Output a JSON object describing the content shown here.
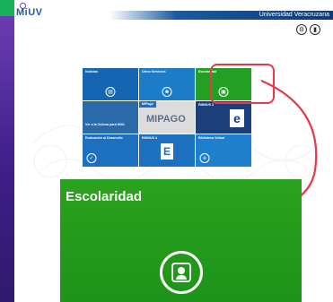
{
  "brand": {
    "logo_text": "MiUV",
    "university": "Universidad Veracruzana"
  },
  "header_icons": [
    "accessibility-icon",
    "user-icon"
  ],
  "tiles": [
    {
      "label": "Noticias",
      "color": "#1565b3"
    },
    {
      "label": "Otros Servicios",
      "color": "#1c7cc8"
    },
    {
      "label": "Escolaridad",
      "color": "#23a023"
    },
    {
      "label": "Ver a la Cultura para MiUL",
      "color": "#2a6aa8"
    },
    {
      "label": "MiPago",
      "color": "#d9d9d9"
    },
    {
      "label": "EMINUS 3",
      "color": "#1a3f7a"
    },
    {
      "label": "Evaluación al Desarrollo",
      "color": "#1d6fbf"
    },
    {
      "label": "EMINUS 4",
      "color": "#1d6fbf"
    },
    {
      "label": "Biblioteca Virtual",
      "color": "#1e7fcc"
    }
  ],
  "mipago_brand": "MIPAGO",
  "zoom": {
    "title": "Escolaridad",
    "color": "#23a023"
  },
  "accent": "#e8384a"
}
